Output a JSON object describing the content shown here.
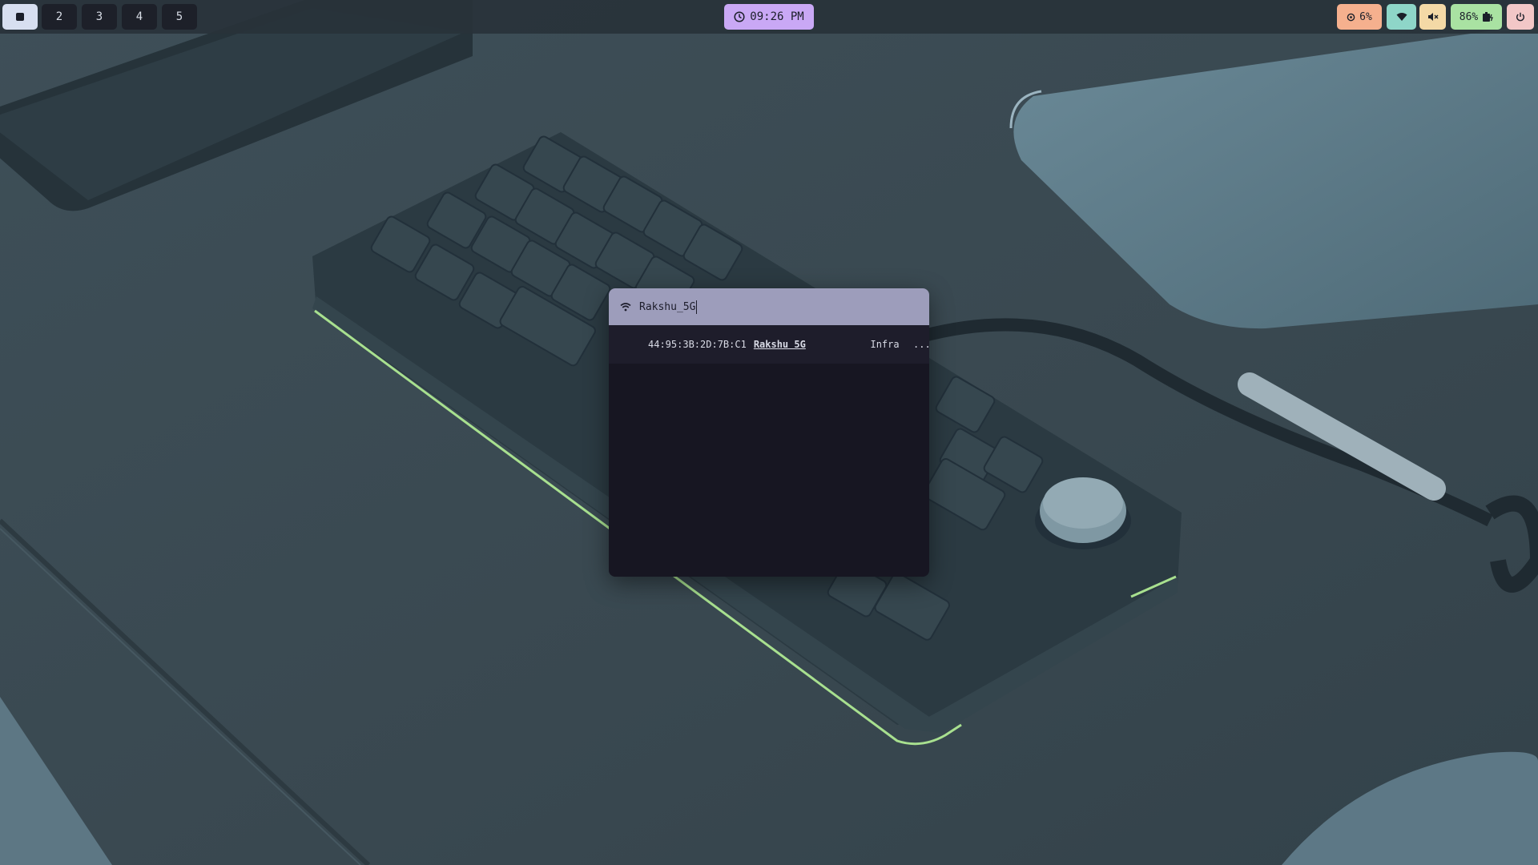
{
  "workspaces": [
    {
      "label": "",
      "active": true
    },
    {
      "label": "2",
      "active": false
    },
    {
      "label": "3",
      "active": false
    },
    {
      "label": "4",
      "active": false
    },
    {
      "label": "5",
      "active": false
    }
  ],
  "clock": {
    "time": "09:26 PM",
    "icon": "clock-icon",
    "color": "#c9a8f5"
  },
  "status": {
    "cpu": {
      "value": "6%",
      "icon": "cpu-icon",
      "color": "#f5b08e"
    },
    "wifi": {
      "icon": "wifi-icon",
      "color": "#8ed6c8"
    },
    "volume": {
      "icon": "speaker-muted-icon",
      "color": "#f4d9a6"
    },
    "battery": {
      "value": "86%",
      "icon": "battery-charging-icon",
      "color": "#a9e2a2"
    },
    "power": {
      "icon": "power-icon",
      "color": "#f2c7c7"
    }
  },
  "wifi_popup": {
    "search_value": "Rakshu_5G",
    "header_color": "#9d9dbb",
    "networks": [
      {
        "bssid": "44:95:3B:2D:7B:C1",
        "ssid": "Rakshu 5G",
        "mode": "Infra",
        "more": "..."
      }
    ]
  }
}
